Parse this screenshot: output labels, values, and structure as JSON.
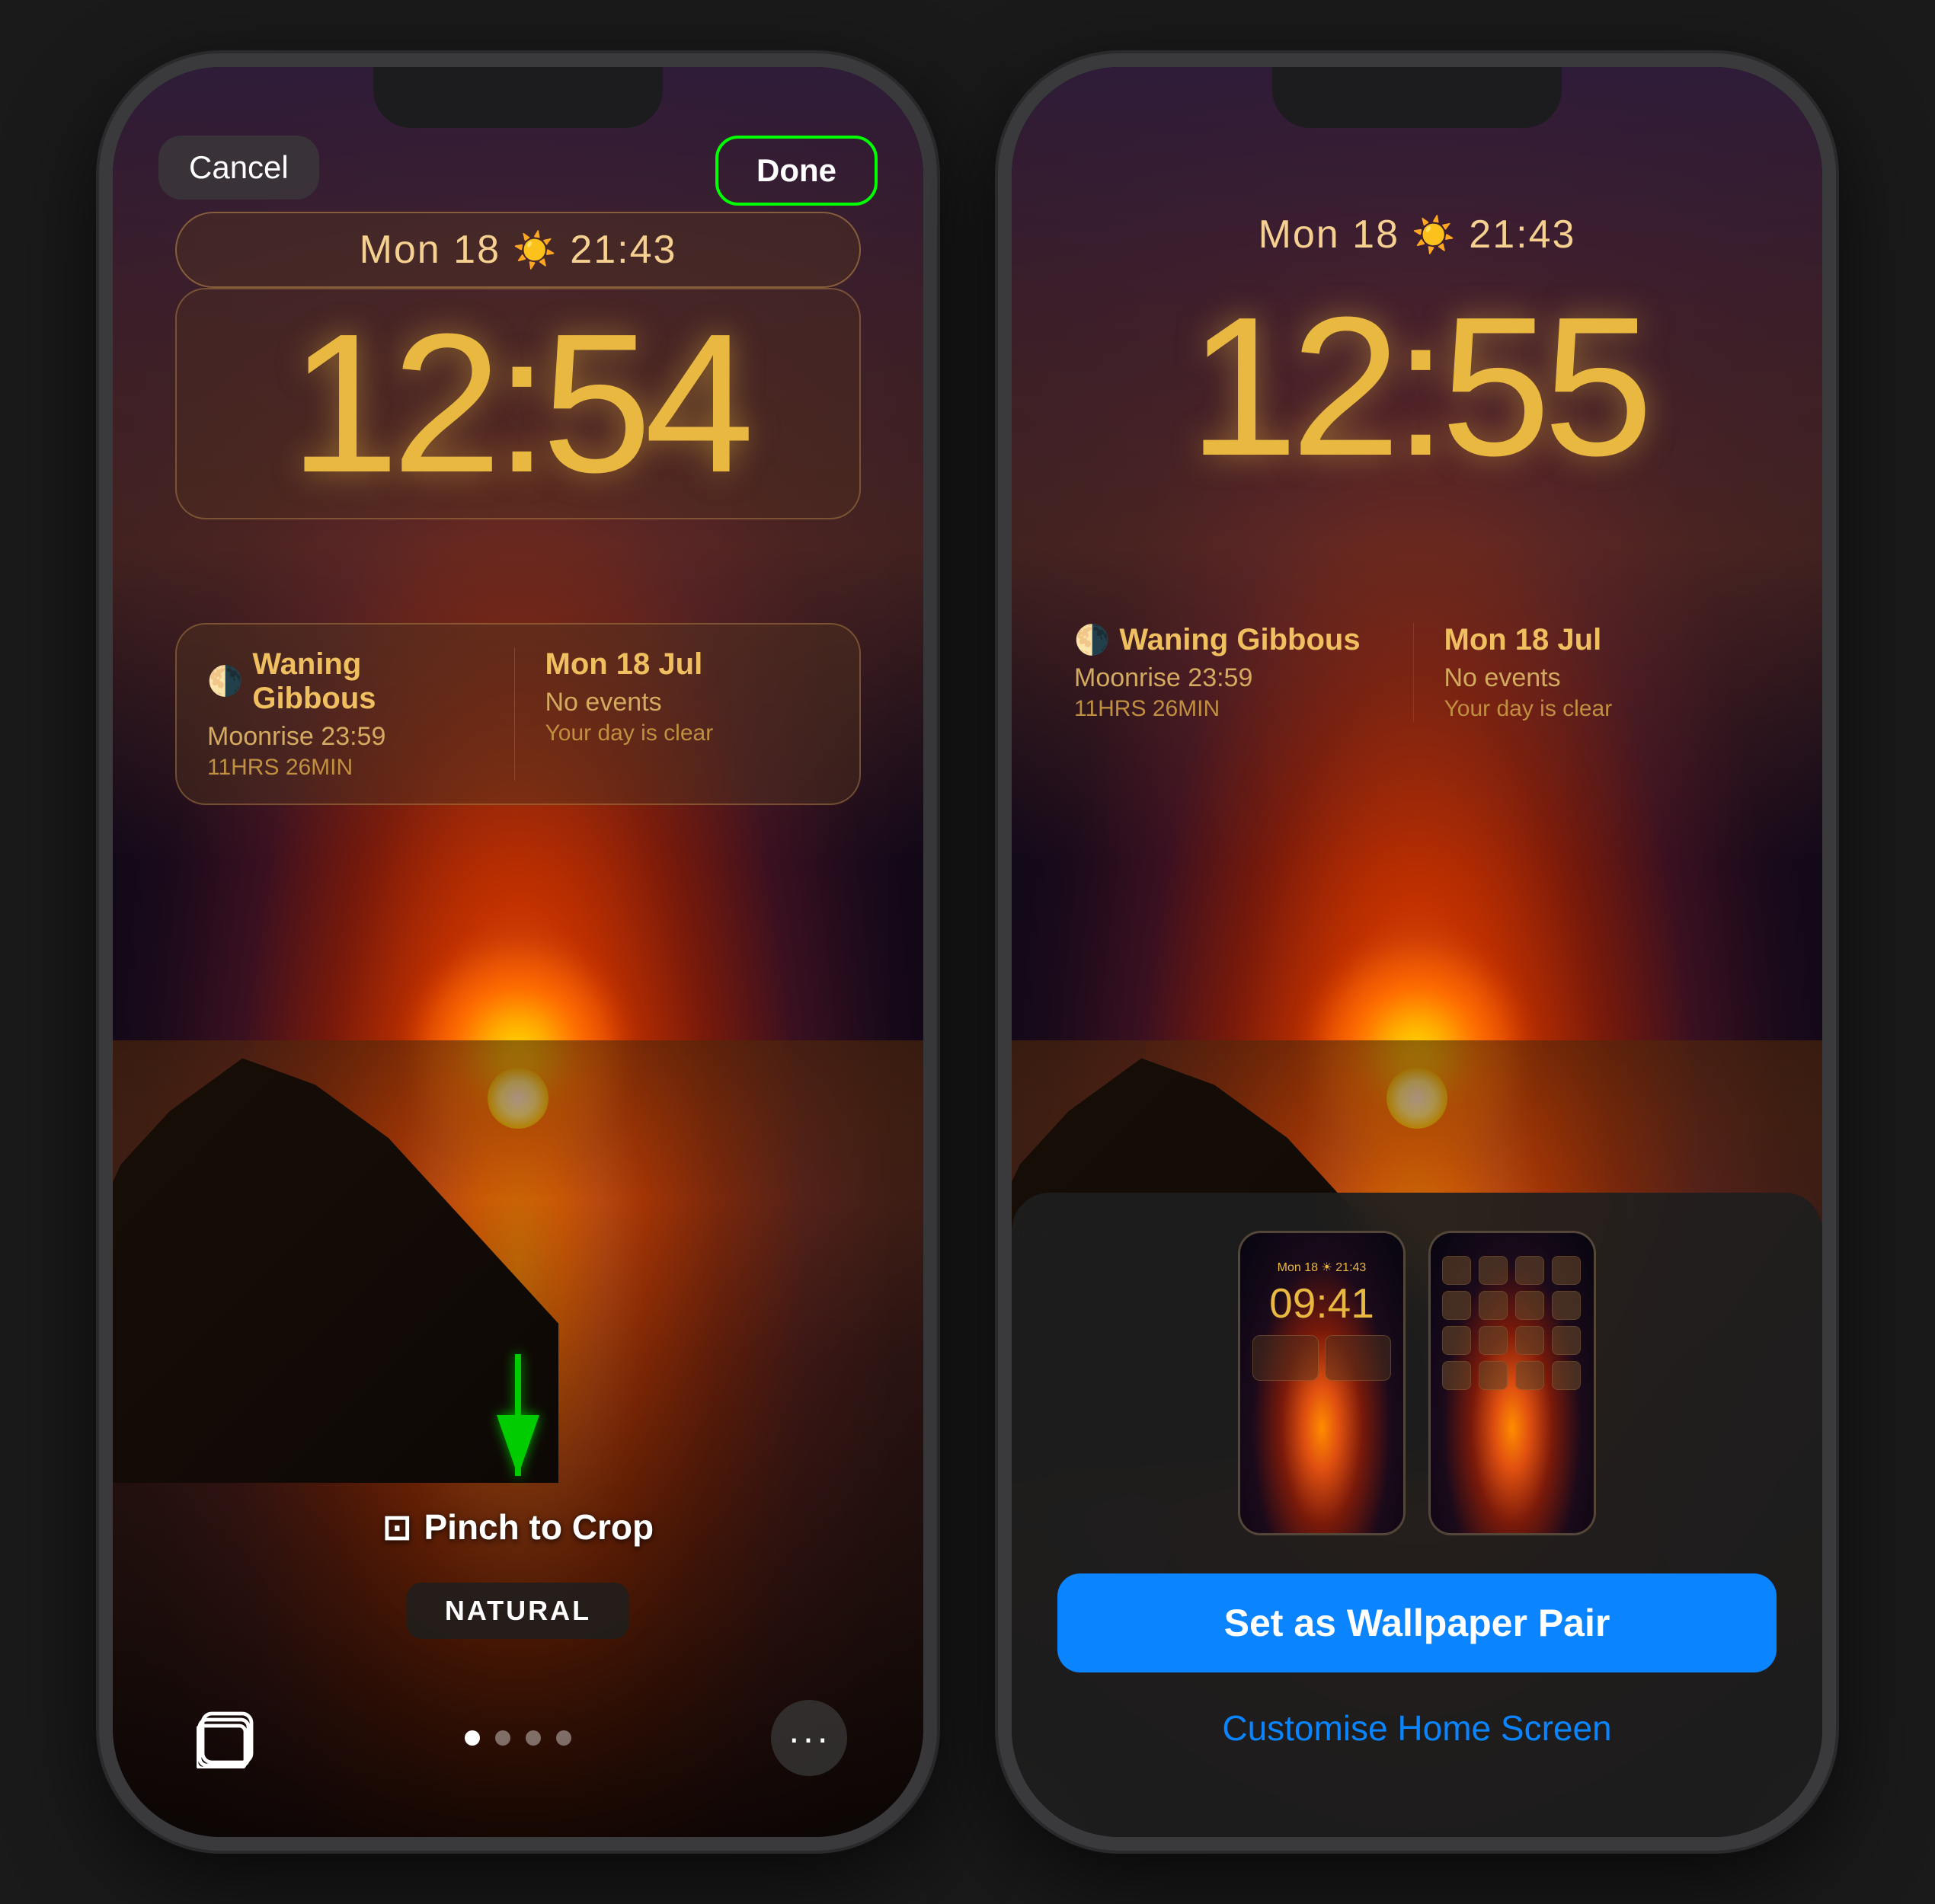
{
  "phone1": {
    "cancel_label": "Cancel",
    "done_label": "Done",
    "date_text": "Mon 18",
    "time_label": "21:43",
    "clock_time": "12:54",
    "widget_moon_title": "Waning Gibbous",
    "widget_moon_sub1": "Moonrise 23:59",
    "widget_moon_sub2": "11HRS 26MIN",
    "widget_calendar_title": "Mon 18 Jul",
    "widget_calendar_sub1": "No events",
    "widget_calendar_sub2": "Your day is clear",
    "pinch_label": "Pinch to Crop",
    "filter_label": "NATURAL",
    "toolbar": {
      "photos_label": "photos",
      "more_label": "···"
    },
    "dots": [
      "active",
      "inactive",
      "inactive",
      "inactive"
    ]
  },
  "phone2": {
    "date_text": "Mon 18",
    "time_label": "21:43",
    "clock_time": "12:55",
    "widget_moon_title": "Waning Gibbous",
    "widget_moon_sub1": "Moonrise 23:59",
    "widget_moon_sub2": "11HRS 26MIN",
    "widget_calendar_title": "Mon 18 Jul",
    "widget_calendar_sub1": "No events",
    "widget_calendar_sub2": "Your day is clear",
    "preview_time": "Mon 18  21:43",
    "preview_clock": "09:41",
    "set_wallpaper_label": "Set as Wallpaper Pair",
    "customise_label": "Customise Home Screen"
  },
  "icons": {
    "sun": "☀",
    "moon": "🌗",
    "crop": "⊡",
    "photos": "⊞"
  },
  "colors": {
    "done_border": "#00ff00",
    "clock_color": "#e8b840",
    "widget_text": "#f0c060",
    "blue_btn": "#0a84ff"
  }
}
